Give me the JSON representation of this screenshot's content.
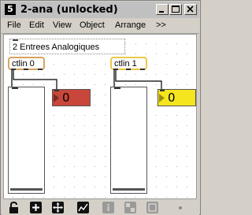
{
  "window": {
    "app_badge": "5",
    "title": "2-ana (unlocked)"
  },
  "menu": [
    "File",
    "Edit",
    "View",
    "Object",
    "Arrange",
    ">>"
  ],
  "patcher": {
    "comment": "2 Entrees Analogiques",
    "objects": [
      {
        "label": "ctlin 0",
        "number": "0",
        "border_color": "#d9a35e",
        "number_color": "#c9473a"
      },
      {
        "label": "ctlin 1",
        "number": "0",
        "border_color": "#e8c84a",
        "number_color": "#f5e51e"
      }
    ],
    "sliders": [
      {
        "value": 0
      },
      {
        "value": 0
      }
    ]
  },
  "toolbar": {
    "icons": [
      "lock-icon",
      "new-object-icon",
      "move-icon",
      "graph-icon",
      "info-icon",
      "grid-icon",
      "presentation-icon"
    ]
  }
}
